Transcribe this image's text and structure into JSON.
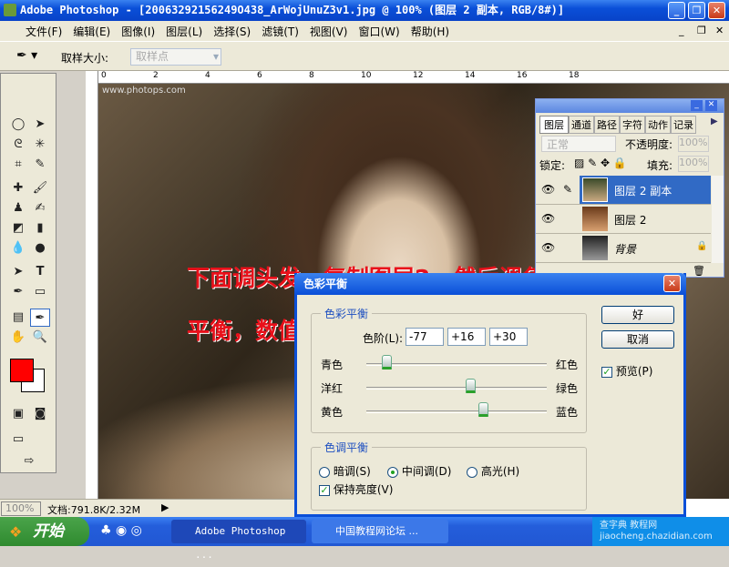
{
  "app": {
    "title": "Adobe Photoshop - [20063292156249O438_ArWojUnuZ3v1.jpg @ 100% (图层 2 副本, RGB/8#)]"
  },
  "menu": [
    "文件(F)",
    "编辑(E)",
    "图像(I)",
    "图层(L)",
    "选择(S)",
    "滤镜(T)",
    "视图(V)",
    "窗口(W)",
    "帮助(H)"
  ],
  "options": {
    "sample_size_label": "取样大小:",
    "sample_size_value": "取样点"
  },
  "ruler": {
    "top_labels": [
      "0",
      "2",
      "4",
      "6",
      "8",
      "10",
      "12",
      "14",
      "16",
      "18"
    ]
  },
  "canvas": {
    "watermark": "www.photops.com"
  },
  "annotation": {
    "line1": "下面调头发，复制图层2，然后调色彩",
    "line2": "平衡，数值如图"
  },
  "status": {
    "zoom": "100%",
    "doc": "文档:791.8K/2.32M"
  },
  "layers_panel": {
    "tabs": [
      "图层",
      "通道",
      "路径",
      "字符",
      "动作",
      "记录"
    ],
    "blend_mode": "正常",
    "opacity_label": "不透明度:",
    "opacity": "100%",
    "lock_label": "锁定:",
    "fill_label": "填充:",
    "fill": "100%",
    "layers": [
      {
        "name": "图层 2 副本",
        "selected": true
      },
      {
        "name": "图层 2",
        "selected": false
      },
      {
        "name": "背景",
        "selected": false,
        "locked": true
      }
    ]
  },
  "dialog": {
    "title": "色彩平衡",
    "color_group": "色彩平衡",
    "levels_label": "色阶(L):",
    "levels": [
      "-77",
      "+16",
      "+30"
    ],
    "sliders": [
      {
        "left": "青色",
        "right": "红色",
        "value": -77
      },
      {
        "left": "洋红",
        "right": "绿色",
        "value": 16
      },
      {
        "left": "黄色",
        "right": "蓝色",
        "value": 30
      }
    ],
    "tone_group": "色调平衡",
    "tones": [
      {
        "label": "暗调(S)",
        "checked": false
      },
      {
        "label": "中间调(D)",
        "checked": true
      },
      {
        "label": "高光(H)",
        "checked": false
      }
    ],
    "preserve_label": "保持亮度(V)",
    "preserve_checked": true,
    "ok": "好",
    "cancel": "取消",
    "preview_label": "预览(P)",
    "preview_checked": true
  },
  "taskbar": {
    "start": "开始",
    "tasks": [
      "Adobe Photoshop ...",
      "中国教程网论坛 ..."
    ],
    "watermark": "查字典 教程网 jiaocheng.chazidian.com"
  },
  "colors": {
    "foreground": "#ff0000",
    "background": "#ffffff",
    "accent": "#0a4fd8"
  }
}
